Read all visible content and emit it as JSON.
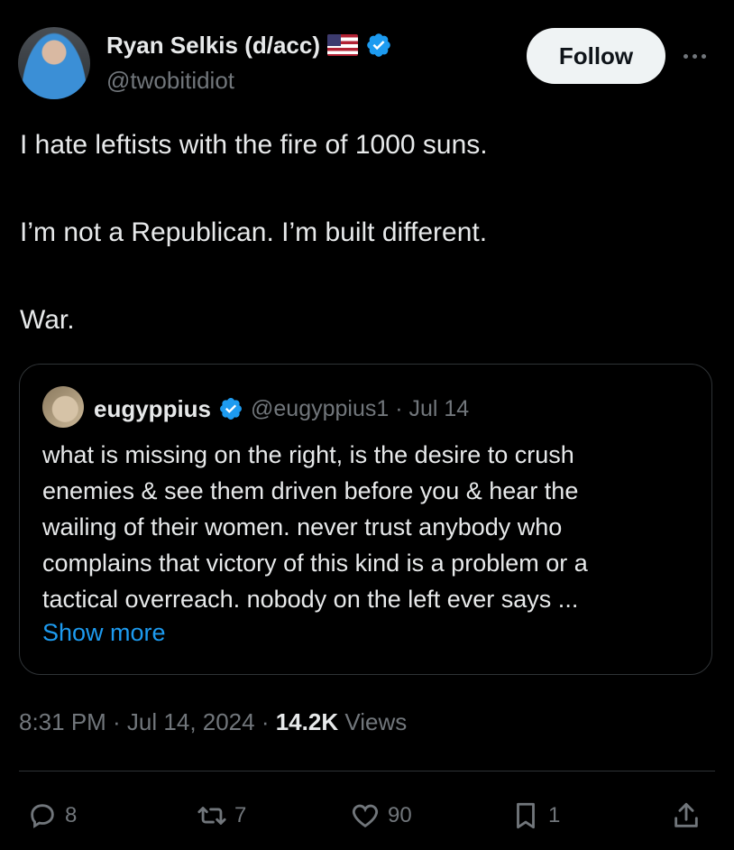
{
  "author": {
    "name": "Ryan Selkis (d/acc)",
    "handle": "@twobitidiot",
    "verified": true
  },
  "follow_label": "Follow",
  "post": {
    "lines": [
      "I hate leftists with the fire of 1000 suns.",
      "I’m not a Republican. I’m built different.",
      "War."
    ]
  },
  "quote": {
    "name": "eugyppius",
    "handle_date": "@eugyppius1 · Jul 14",
    "lines": [
      "what is missing on the right, is the desire to crush",
      "enemies & see them driven before you & hear the",
      "wailing of their women. never trust anybody who",
      "complains that victory of this kind is a problem or a",
      "tactical overreach. nobody on the left ever says ..."
    ],
    "show_more": "Show more"
  },
  "meta": {
    "time": "8:31 PM · Jul 14, 2024 · ",
    "views_count": "14.2K",
    "views_label": " Views"
  },
  "actions": {
    "replies": "8",
    "reposts": "7",
    "likes": "90",
    "bookmarks": "1"
  },
  "colors": {
    "background": "#000000",
    "text": "#e7e9ea",
    "muted": "#71767b",
    "accent": "#1d9bf0",
    "border": "#2f3336"
  }
}
